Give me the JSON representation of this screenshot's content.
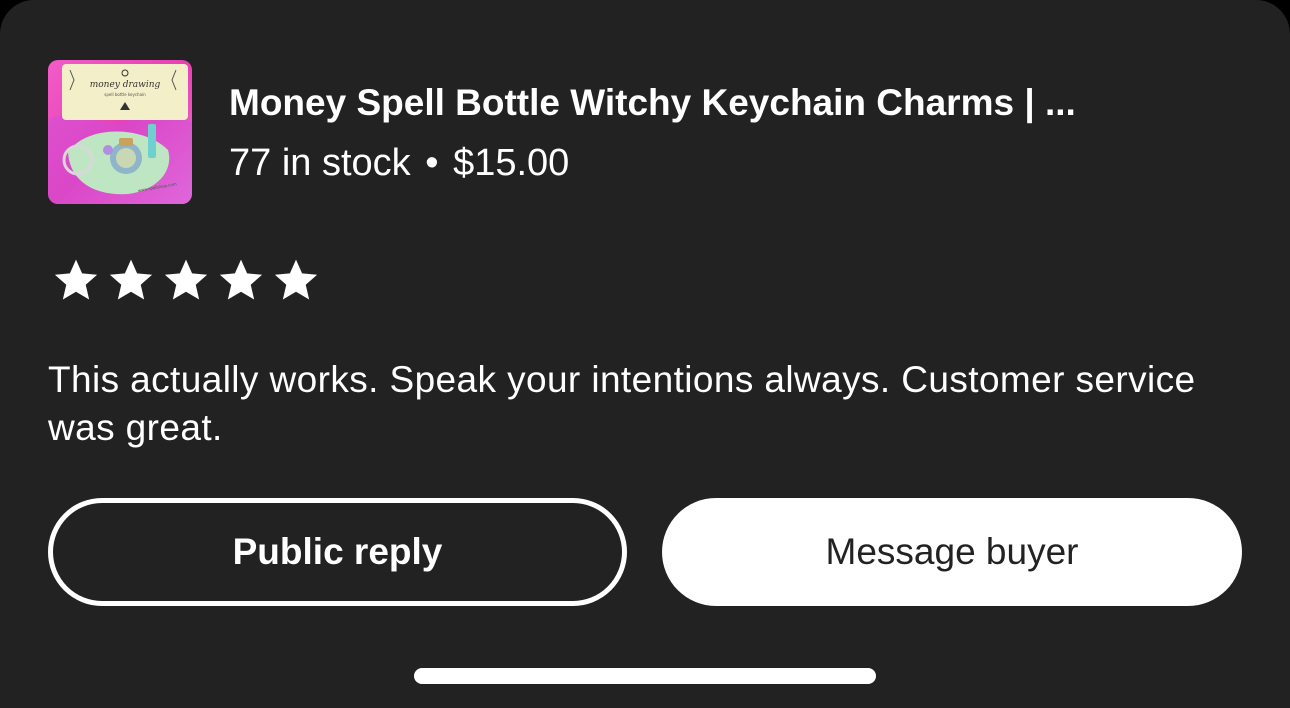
{
  "product": {
    "title": "Money Spell Bottle Witchy Keychain Charms | ...",
    "stock": "77 in stock",
    "separator": "•",
    "price": "$15.00",
    "image_alt": "product-thumbnail"
  },
  "review": {
    "rating": 5,
    "rating_max": 5,
    "text": "This actually works. Speak your intentions always. Customer service was great."
  },
  "actions": {
    "public_reply_label": "Public reply",
    "message_buyer_label": "Message buyer"
  },
  "colors": {
    "background": "#222222",
    "text": "#ffffff",
    "button_fill": "#ffffff",
    "thumb_pink": "#e83fb5"
  }
}
